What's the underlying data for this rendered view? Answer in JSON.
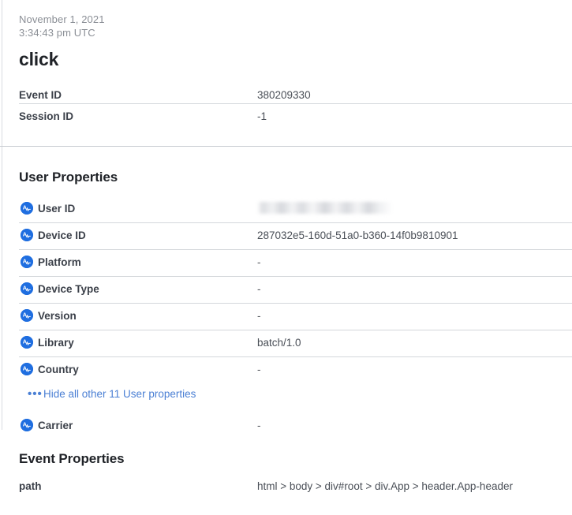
{
  "header": {
    "date": "November 1, 2021",
    "time": "3:34:43 pm UTC",
    "event_name": "click"
  },
  "top_properties": [
    {
      "label": "Event ID",
      "value": "380209330"
    },
    {
      "label": "Session ID",
      "value": "-1"
    }
  ],
  "user_properties": {
    "title": "User Properties",
    "icon": "amplitude-icon",
    "rows": [
      {
        "label": "User ID",
        "value": "",
        "redacted": true
      },
      {
        "label": "Device ID",
        "value": "287032e5-160d-51a0-b360-14f0b9810901",
        "redacted": false
      },
      {
        "label": "Platform",
        "value": "-",
        "redacted": false
      },
      {
        "label": "Device Type",
        "value": "-",
        "redacted": false
      },
      {
        "label": "Version",
        "value": "-",
        "redacted": false
      },
      {
        "label": "Library",
        "value": "batch/1.0",
        "redacted": false
      },
      {
        "label": "Country",
        "value": "-",
        "redacted": false
      }
    ],
    "toggle_link": {
      "dots": "•••",
      "label": "Hide all other 11 User properties"
    },
    "extra_rows": [
      {
        "label": "Carrier",
        "value": "-",
        "redacted": false
      }
    ]
  },
  "event_properties": {
    "title": "Event Properties",
    "rows": [
      {
        "label": "path",
        "value": "html > body > div#root > div.App > header.App-header"
      }
    ]
  },
  "colors": {
    "icon_blue": "#1f6ee0",
    "link_blue": "#4a7fd4",
    "text_dark": "#1f2227",
    "label_gray": "#3b4049",
    "value_gray": "#4a4f57",
    "muted_gray": "#8b8f96",
    "rule_gray": "#d4d7db"
  }
}
